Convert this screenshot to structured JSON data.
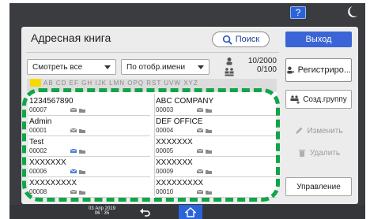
{
  "window": {
    "help_label": "?"
  },
  "header": {
    "title": "Адресная книга",
    "search_label": "Поиск",
    "exit_label": "Выход"
  },
  "filters": {
    "view_selected": "Смотреть все",
    "sort_selected": "По отобр.имени"
  },
  "counts": {
    "line1": "10/2000",
    "line2": "0/100"
  },
  "tabs": {
    "active": "",
    "rest": "AB CD EF GH IJK LMN OPQ RST UVW XYZ"
  },
  "entries": [
    {
      "name": "1234567890",
      "number": "00007"
    },
    {
      "name": "ABC COMPANY",
      "number": "00003"
    },
    {
      "name": "Admin",
      "number": "00001"
    },
    {
      "name": "DEF OFFICE",
      "number": "00004"
    },
    {
      "name": "Test",
      "number": "00002"
    },
    {
      "name": "XXXXXXX",
      "number": "00005"
    },
    {
      "name": "XXXXXXX",
      "number": "00006"
    },
    {
      "name": "XXXXXXX",
      "number": "00009"
    },
    {
      "name": "XXXXXXXXX",
      "number": "00008"
    },
    {
      "name": "XXXXXXXXX",
      "number": "00010"
    }
  ],
  "side": {
    "register_label": "Регистриро...",
    "group_label": "Созд.группу",
    "change_label": "Изменить",
    "delete_label": "Удалить",
    "manage_label": "Управление"
  },
  "status": {
    "date": "03 Апр 2019",
    "time": "06 : 35"
  },
  "colors": {
    "accent": "#3b65d6",
    "highlight": "#f6d900",
    "dashed_frame": "#10a549"
  },
  "icons": [
    "help-icon",
    "moon-icon",
    "search-icon",
    "user-icon",
    "group-icon",
    "pencil-icon",
    "trash-icon",
    "mail-icon",
    "folder-icon",
    "back-icon",
    "home-icon"
  ]
}
